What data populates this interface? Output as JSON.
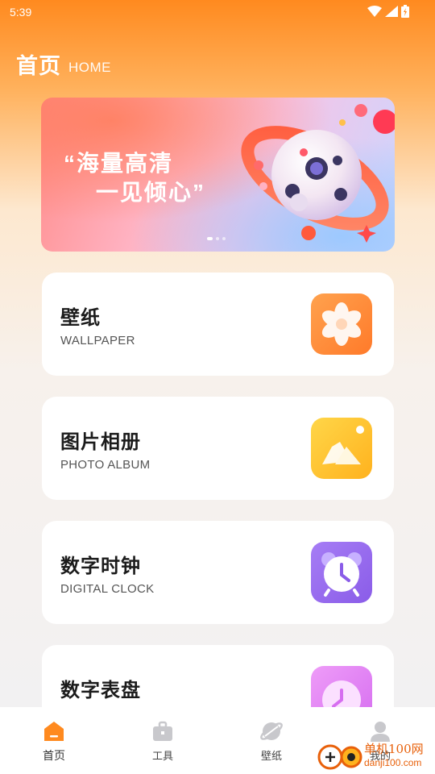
{
  "status_bar": {
    "time": "5:39"
  },
  "header": {
    "title": "首页",
    "subtitle": "HOME"
  },
  "banner": {
    "line1": "“海量高清",
    "line2": "一见倾心”",
    "page_count": 3,
    "active_page": 1
  },
  "cards": [
    {
      "title": "壁纸",
      "subtitle": "WALLPAPER",
      "icon": "flower-icon",
      "color": "#ff8a3c"
    },
    {
      "title": "图片相册",
      "subtitle": "PHOTO ALBUM",
      "icon": "mountain-photo-icon",
      "color": "#ffc12e"
    },
    {
      "title": "数字时钟",
      "subtitle": "DIGITAL CLOCK",
      "icon": "alarm-clock-icon",
      "color": "#9b6cf0"
    },
    {
      "title": "数字表盘",
      "subtitle": "",
      "icon": "clock-dial-icon",
      "color": "#e07ff0"
    }
  ],
  "bottom_nav": [
    {
      "label": "首页",
      "icon": "home-icon",
      "active": true
    },
    {
      "label": "工具",
      "icon": "toolbox-icon",
      "active": false
    },
    {
      "label": "壁纸",
      "icon": "wallpaper-icon",
      "active": false
    },
    {
      "label": "我的",
      "icon": "user-icon",
      "active": false
    }
  ],
  "watermark": {
    "line1": "单机100网",
    "line2": "danji100.com"
  },
  "colors": {
    "accent": "#ff8a1f",
    "nav_active": "#ff8a1f",
    "nav_inactive": "#c8c8cc"
  }
}
